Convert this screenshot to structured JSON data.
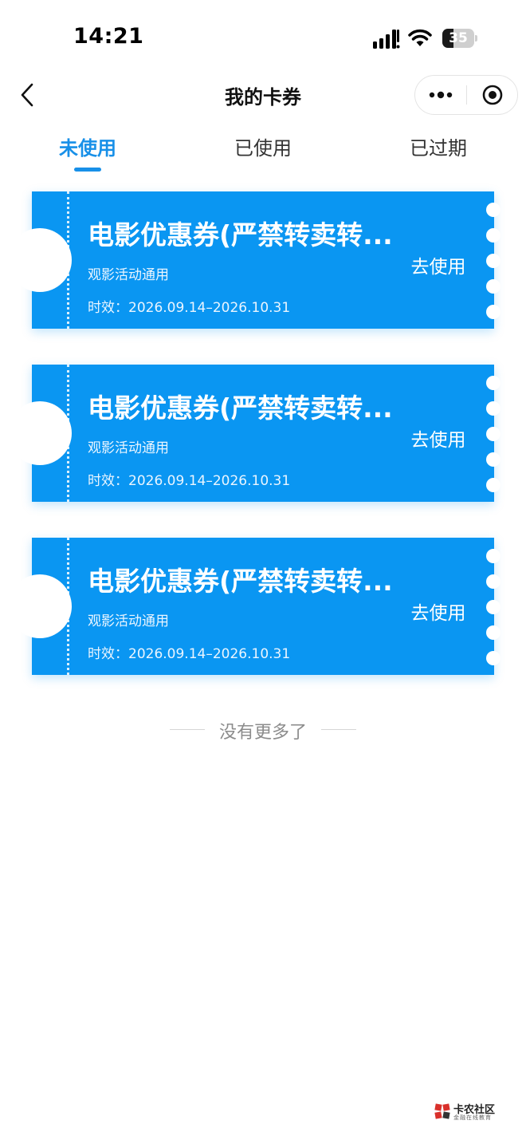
{
  "status_bar": {
    "time": "14:21",
    "battery": "35",
    "battery_level": 0.35,
    "icons": [
      "signal-icon",
      "wifi-icon",
      "battery-icon"
    ]
  },
  "nav": {
    "title": "我的卡券",
    "icons": [
      "back-arrow-icon",
      "more-dots-icon",
      "target-close-icon"
    ]
  },
  "tabs": [
    {
      "label": "未使用",
      "active": true
    },
    {
      "label": "已使用",
      "active": false
    },
    {
      "label": "已过期",
      "active": false
    }
  ],
  "coupons": [
    {
      "title": "电影优惠券(严禁转卖转...",
      "desc": "观影活动通用",
      "validity": "时效：2026.09.14–2026.10.31",
      "action": "去使用"
    },
    {
      "title": "电影优惠券(严禁转卖转...",
      "desc": "观影活动通用",
      "validity": "时效：2026.09.14–2026.10.31",
      "action": "去使用"
    },
    {
      "title": "电影优惠券(严禁转卖转...",
      "desc": "观影活动通用",
      "validity": "时效：2026.09.14–2026.10.31",
      "action": "去使用"
    }
  ],
  "end_note": "没有更多了",
  "watermark": {
    "name": "卡农社区",
    "subtitle": "金融在线教育"
  },
  "colors": {
    "accent": "#1890e8",
    "coupon_bg": "#0a96f2",
    "text_muted": "#8c8c8c"
  }
}
